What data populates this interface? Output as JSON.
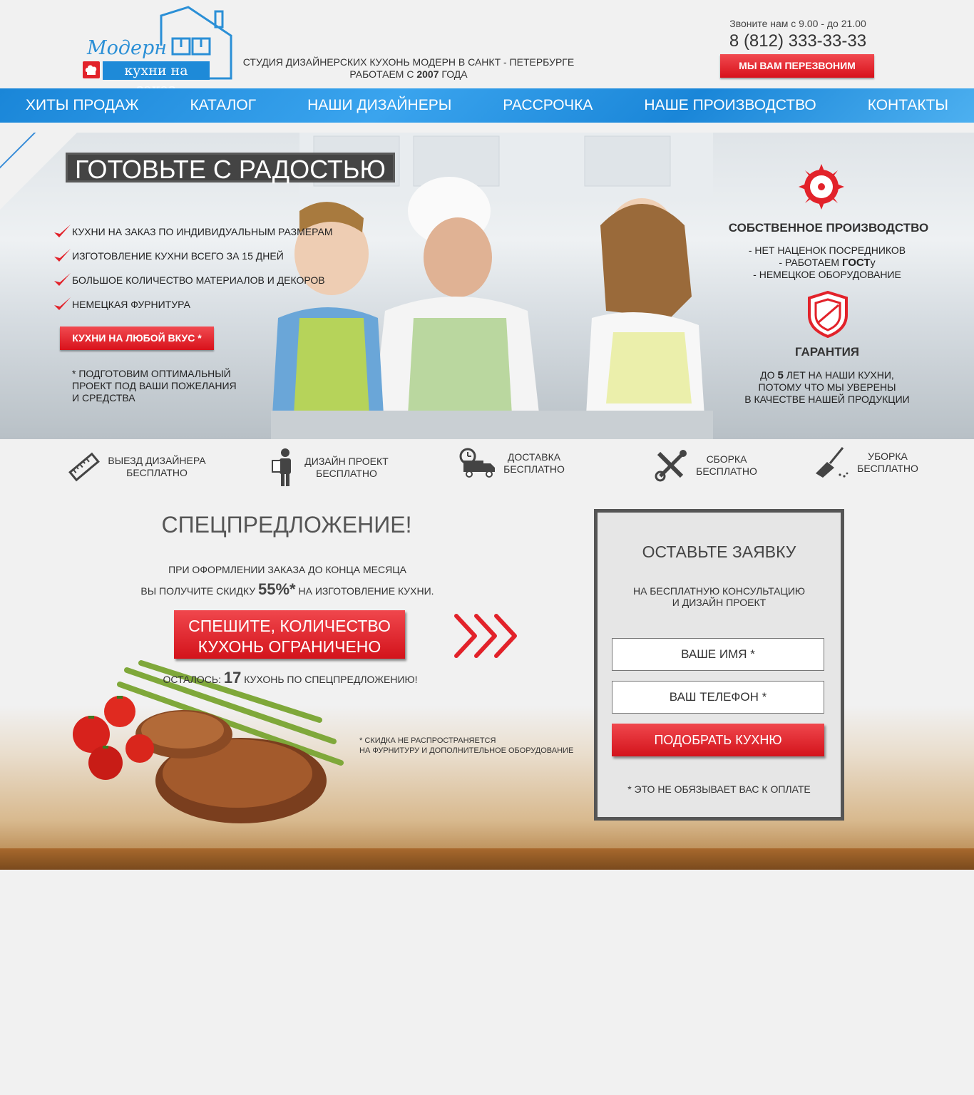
{
  "header": {
    "logo_script": "Модерн",
    "logo_sub": "кухни на заказ",
    "tagline_line1": "СТУДИЯ ДИЗАЙНЕРСКИХ КУХОНЬ МОДЕРН В САНКТ - ПЕТЕРБУРГЕ",
    "tagline_line2_prefix": "РАБОТАЕМ С ",
    "tagline_line2_year": "2007",
    "tagline_line2_suffix": " ГОДА",
    "call_hours": "Звоните нам с 9.00 - до 21.00",
    "phone": "8 (812) 333-33-33",
    "callback_label": "МЫ ВАМ ПЕРЕЗВОНИМ"
  },
  "nav": {
    "items": [
      {
        "label": "ХИТЫ ПРОДАЖ"
      },
      {
        "label": "КАТАЛОГ"
      },
      {
        "label": "НАШИ ДИЗАЙНЕРЫ"
      },
      {
        "label": "РАССРОЧКА"
      },
      {
        "label": "НАШЕ ПРОИЗВОДСТВО"
      },
      {
        "label": "КОНТАКТЫ"
      }
    ]
  },
  "hero": {
    "title": "ГОТОВЬТЕ С РАДОСТЬЮ",
    "checks": [
      "КУХНИ НА ЗАКАЗ ПО ИНДИВИДУАЛЬНЫМ РАЗМЕРАМ",
      "ИЗГОТОВЛЕНИЕ КУХНИ ВСЕГО ЗА 15 ДНЕЙ",
      "БОЛЬШОЕ КОЛИЧЕСТВО МАТЕРИАЛОВ И ДЕКОРОВ",
      "НЕМЕЦКАЯ ФУРНИТУРА"
    ],
    "taste_button": "КУХНИ НА ЛЮБОЙ ВКУС *",
    "note_line1": "* ПОДГОТОВИМ ОПТИМАЛЬНЫЙ",
    "note_line2": "ПРОЕКТ ПОД ВАШИ ПОЖЕЛАНИЯ",
    "note_line3": "И СРЕДСТВА",
    "production_title": "СОБСТВЕННОЕ ПРОИЗВОДСТВО",
    "production_line1": "-  НЕТ НАЦЕНОК ПОСРЕДНИКОВ",
    "production_line2_prefix": "- РАБОТАЕМ ",
    "production_line2_bold": "ГОСТ",
    "production_line2_suffix": "у",
    "production_line3": "- НЕМЕЦКОЕ ОБОРУДОВАНИЕ",
    "guarantee_title": "ГАРАНТИЯ",
    "guarantee_line1_prefix": "ДО ",
    "guarantee_line1_bold": "5",
    "guarantee_line1_suffix": " ЛЕТ НА НАШИ КУХНИ,",
    "guarantee_line2": "ПОТОМУ ЧТО МЫ УВЕРЕНЫ",
    "guarantee_line3": "В КАЧЕСТВЕ НАШЕЙ ПРОДУКЦИИ"
  },
  "features": [
    {
      "line1": "ВЫЕЗД ДИЗАЙНЕРА",
      "line2": "БЕСПЛАТНО",
      "icon": "ruler-icon"
    },
    {
      "line1": "ДИЗАЙН ПРОЕКТ",
      "line2": "БЕСПЛАТНО",
      "icon": "designer-icon"
    },
    {
      "line1": "ДОСТАВКА",
      "line2": "БЕСПЛАТНО",
      "icon": "truck-icon"
    },
    {
      "line1": "СБОРКА",
      "line2": "БЕСПЛАТНО",
      "icon": "tools-icon"
    },
    {
      "line1": "УБОРКА",
      "line2": "БЕСПЛАТНО",
      "icon": "broom-icon"
    }
  ],
  "offer": {
    "title": "СПЕЦПРЕДЛОЖЕНИЕ!",
    "line1": "ПРИ ОФОРМЛЕНИИ ЗАКАЗА ДО КОНЦА МЕСЯЦА",
    "line2_prefix": "ВЫ ПОЛУЧИТЕ СКИДКУ ",
    "discount": "55%*",
    "line2_suffix": " НА ИЗГОТОВЛЕНИЕ КУХНИ.",
    "hurry_line1": "СПЕШИТЕ, КОЛИЧЕСТВО",
    "hurry_line2": "КУХОНЬ ОГРАНИЧЕНО",
    "remaining_prefix": "ОСТАЛОСЬ: ",
    "remaining_count": "17",
    "remaining_suffix": "  КУХОНЬ ПО СПЕЦПРЕДЛОЖЕНИЮ!",
    "fine_line1": "* СКИДКА НЕ РАСПРОСТРАНЯЕТСЯ",
    "fine_line2": "НА ФУРНИТУРУ И ДОПОЛНИТЕЛЬНОЕ ОБОРУДОВАНИЕ"
  },
  "form": {
    "title": "ОСТАВЬТЕ ЗАЯВКУ",
    "sub_line1": "НА БЕСПЛАТНУЮ КОНСУЛЬТАЦИЮ",
    "sub_line2": "И  ДИЗАЙН ПРОЕКТ",
    "name_placeholder": "ВАШЕ ИМЯ *",
    "phone_placeholder": "ВАШ ТЕЛЕФОН *",
    "submit_label": "ПОДОБРАТЬ КУХНЮ",
    "note": "* ЭТО НЕ ОБЯЗЫВАЕТ ВАС К ОПЛАТЕ"
  },
  "colors": {
    "accent_red": "#e2222a",
    "nav_blue": "#1a86d8",
    "dark": "#444444"
  }
}
